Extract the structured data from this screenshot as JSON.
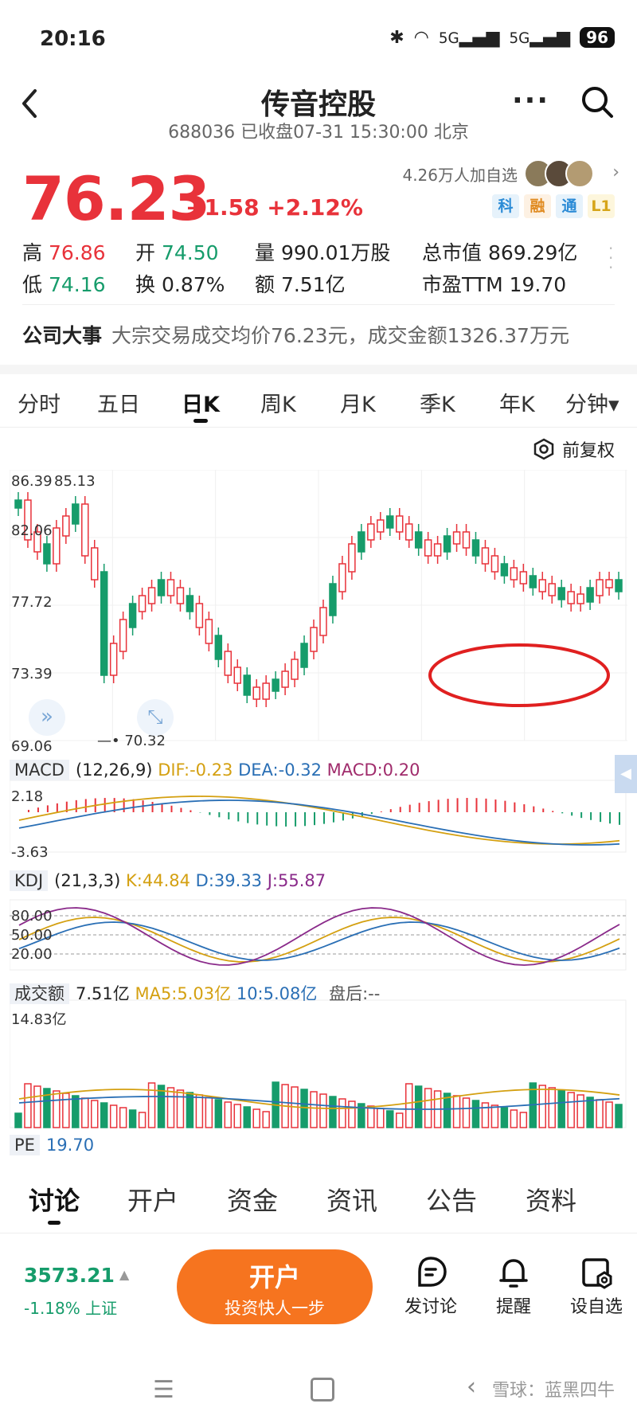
{
  "status_bar": {
    "time": "20:16",
    "battery": "96",
    "signal1": "5G",
    "signal2": "5G"
  },
  "header": {
    "title": "传音控股",
    "subtitle": "688036 已收盘07-31 15:30:00 北京"
  },
  "quote": {
    "price": "76.23",
    "change": "+1.58 +2.12%",
    "followers": "4.26万人加自选",
    "badges": [
      "科",
      "融",
      "通",
      "L1"
    ],
    "high_label": "高",
    "high": "76.86",
    "open_label": "开",
    "open": "74.50",
    "volume": "量 990.01万股",
    "market_cap": "总市值 869.29亿",
    "low_label": "低",
    "low": "74.16",
    "turnover_label": "换",
    "turnover": "0.87%",
    "amount": "额 7.51亿",
    "pe_ttm": "市盈TTM 19.70"
  },
  "event": {
    "label": "公司大事",
    "text": "大宗交易成交均价76.23元，成交金额1326.37万元"
  },
  "tabs": [
    "分时",
    "五日",
    "日K",
    "周K",
    "月K",
    "季K",
    "年K",
    "分钟▾"
  ],
  "restore_label": "前复权",
  "indicators": {
    "macd": {
      "name": "MACD",
      "params": "(12,26,9)",
      "dif": "DIF:-0.23",
      "dea": "DEA:-0.32",
      "macd": "MACD:0.20",
      "top": "2.18",
      "bottom": "-3.63"
    },
    "kdj": {
      "name": "KDJ",
      "params": "(21,3,3)",
      "k": "K:44.84",
      "d": "D:39.33",
      "j": "J:55.87",
      "levels": [
        "80.00",
        "50.00",
        "20.00"
      ]
    },
    "volume": {
      "name": "成交额",
      "value": "7.51亿",
      "ma5": "MA5:5.03亿",
      "ma10": "10:5.08亿",
      "after": "盘后:--",
      "top": "14.83亿"
    },
    "pe": {
      "name": "PE",
      "value": "19.70"
    }
  },
  "chart_data": {
    "type": "candlestick",
    "y_ticks": [
      "86.39",
      "82.06",
      "77.72",
      "73.39",
      "69.06"
    ],
    "max_label": "85.13",
    "min_label": "70.32",
    "ylim": [
      69.06,
      86.39
    ]
  },
  "bottom_tabs": [
    "讨论",
    "开户",
    "资金",
    "资讯",
    "公告",
    "资料"
  ],
  "footer": {
    "index_value": "3573.21",
    "index_change": "-1.18% 上证",
    "open_btn": "开户",
    "open_sub": "投资快人一步",
    "post": "发讨论",
    "alert": "提醒",
    "watchlist": "设自选"
  },
  "watermark": "雪球：蓝黑四牛",
  "colors": {
    "up": "#e8323a",
    "down": "#169c6b",
    "accent": "#f6741f"
  }
}
